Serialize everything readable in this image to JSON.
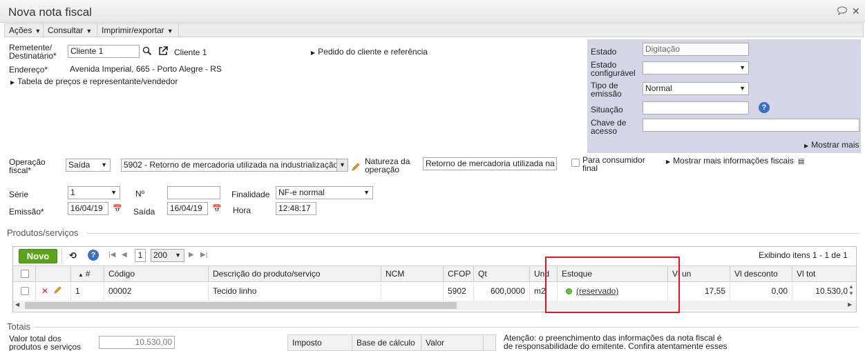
{
  "window": {
    "title": "Nova nota fiscal",
    "chat_icon": "speech-bubble-icon",
    "close_icon": "close-icon"
  },
  "menu": {
    "items": [
      "Ações",
      "Consultar",
      "Imprimir/exportar"
    ]
  },
  "form": {
    "remetente_label": "Remetente/\nDestinatário*",
    "remetente_value": "Cliente 1",
    "remetente_link": "Cliente 1",
    "endereco_label": "Endereço*",
    "endereco_value": "Avenida Imperial, 665 - Porto Alegre - RS",
    "tabela_link": "Tabela de preços e representante/vendedor",
    "pedido_link": "Pedido do cliente e referência",
    "operacao_label": "Operação\nfiscal*",
    "operacao_value": "Saída",
    "cfop_value": "5902 - Retorno de mercadoria utilizada na industrialização",
    "natureza_label": "Natureza da\noperação",
    "natureza_value": "Retorno de mercadoria utilizada na",
    "consumidor_label": "Para consumidor\nfinal",
    "mais_fiscais_link": "Mostrar mais informações fiscais",
    "serie_label": "Série",
    "serie_value": "1",
    "numero_label": "Nº",
    "numero_value": "",
    "finalidade_label": "Finalidade",
    "finalidade_value": "NF-e normal",
    "emissao_label": "Emissão*",
    "emissao_value": "16/04/19",
    "saida_label": "Saída",
    "saida_value": "16/04/19",
    "hora_label": "Hora",
    "hora_value": "12:48:17"
  },
  "status_panel": {
    "estado_label": "Estado",
    "estado_value": "Digitação",
    "estado_conf_label": "Estado\nconfigurável",
    "estado_conf_value": "",
    "tipo_label": "Tipo de\nemissão",
    "tipo_value": "Normal",
    "situacao_label": "Situação",
    "situacao_value": "",
    "chave_label": "Chave de\nacesso",
    "chave_value": "",
    "mostrar_mais": "Mostrar mais"
  },
  "produtos": {
    "section_title": "Produtos/serviços",
    "novo_button": "Novo",
    "page_value": "1",
    "page_size": "200",
    "exibindo": "Exibindo itens 1 - 1 de 1",
    "columns": [
      "#",
      "Código",
      "Descrição do produto/serviço",
      "NCM",
      "CFOP",
      "Qt",
      "Und",
      "Estoque",
      "Vl un",
      "Vl desconto",
      "Vl tot"
    ],
    "rows": [
      {
        "num": "1",
        "codigo": "00002",
        "descricao": "Tecido linho",
        "ncm": "",
        "cfop": "5902",
        "qt": "600,0000",
        "und": "m2",
        "estoque": "(reservado)",
        "vl_un": "17,55",
        "vl_desconto": "0,00",
        "vl_tot": "10.530,0"
      }
    ]
  },
  "totais": {
    "section_title": "Totais",
    "valor_total_label": "Valor total dos\nprodutos e serviços",
    "valor_total_value": "10.530,00",
    "imposto_cols": [
      "Imposto",
      "Base de cálculo",
      "Valor"
    ],
    "atencao": "Atenção: o preenchimento das informações da nota fiscal é\nde responsabilidade do emitente. Confira atentamente esses"
  },
  "colors": {
    "novo_green": "#5aa51c",
    "panel_bg": "#d5d5e8",
    "highlight_red": "#e4141e",
    "status_dot": "#67c23a"
  }
}
